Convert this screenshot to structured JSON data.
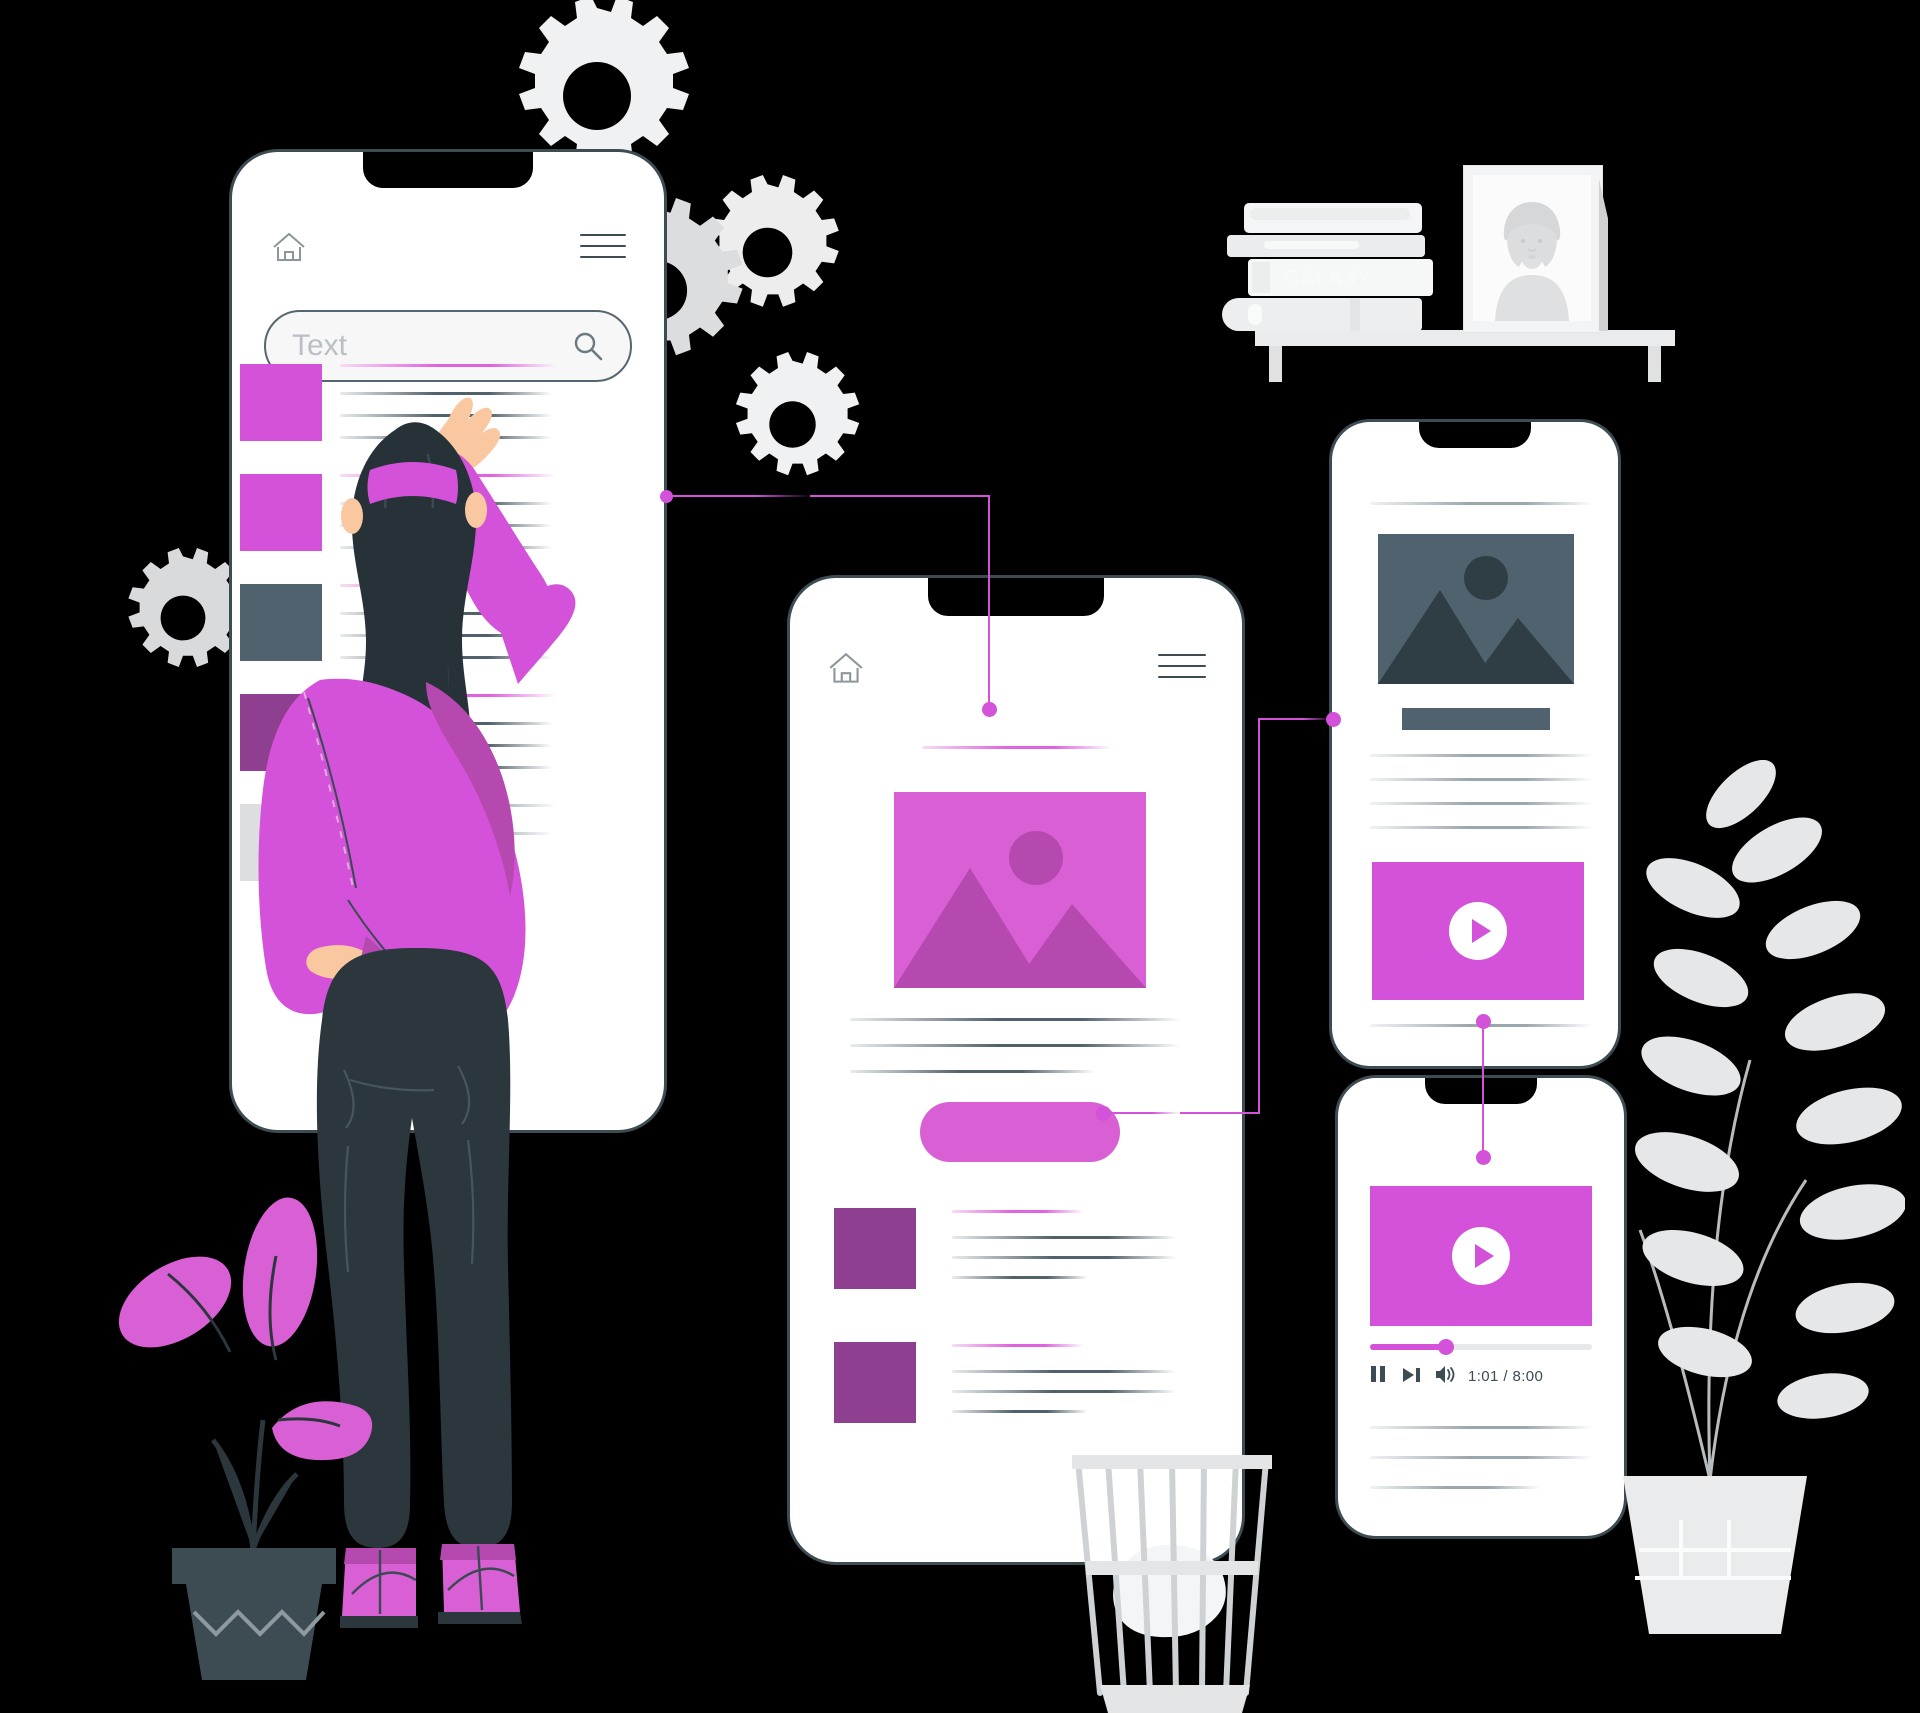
{
  "scene": {
    "title": "App design concept illustration",
    "palette": {
      "magenta": "#d352d9",
      "magenta_light": "#d95fd4",
      "magenta_deep": "#8f3f8f",
      "slate": "#3d4b53",
      "slate_mid": "#4f626d",
      "gray_light": "#e9ebec",
      "white": "#ffffff",
      "pink_leaf": "#d95fd4"
    }
  },
  "phone_left": {
    "name": "Search results phone",
    "home_icon": "home-icon",
    "menu_icon": "hamburger-menu-icon",
    "search": {
      "value": "Text",
      "placeholder": "Text",
      "icon": "search-icon"
    },
    "list_items": [
      {
        "thumb_color": "#d352d9",
        "lines": 4
      },
      {
        "thumb_color": "#d352d9",
        "lines": 4
      },
      {
        "thumb_color": "#4f626d",
        "lines": 4
      },
      {
        "thumb_color": "#dcdedf",
        "lines": 4
      }
    ]
  },
  "phone_center": {
    "name": "Article detail phone",
    "home_icon": "home-icon",
    "menu_icon": "hamburger-menu-icon",
    "hero_image": {
      "color": "#d95fd4",
      "icon": "image-placeholder-icon"
    },
    "cta_button": {
      "label": "",
      "color": "#d95fd4"
    },
    "list_items": [
      {
        "thumb_color": "#8f3f8f"
      },
      {
        "thumb_color": "#8f3f8f"
      }
    ]
  },
  "phone_top_right": {
    "name": "Media article phone",
    "hero_image": {
      "color": "#4f626d",
      "icon": "image-placeholder-icon"
    },
    "heading_bar_color": "#4f626d",
    "video_thumb": {
      "color": "#d352d9",
      "icon": "play-icon"
    }
  },
  "phone_bottom_right": {
    "name": "Video player phone",
    "video_thumb": {
      "color": "#d352d9",
      "icon": "play-icon"
    },
    "player": {
      "progress_percent": 34,
      "time_label": "1:01 / 8:00",
      "controls": [
        {
          "name": "pause-icon",
          "glyph": "pause"
        },
        {
          "name": "next-track-icon",
          "glyph": "next"
        },
        {
          "name": "volume-icon",
          "glyph": "volume"
        }
      ]
    }
  },
  "shelf": {
    "name": "wall-shelf",
    "books": [
      {
        "spine_text": ""
      },
      {
        "spine_text": ""
      },
      {
        "spine_text": "GALAXY"
      },
      {
        "spine_text": ""
      }
    ],
    "photo_frame": {
      "name": "portrait-photo-frame",
      "subject": "woman-portrait"
    }
  },
  "decor": {
    "gears": [
      {
        "name": "gear-large-top"
      },
      {
        "name": "gear-medium-right"
      },
      {
        "name": "gear-medium-left"
      },
      {
        "name": "gear-small-bottom"
      },
      {
        "name": "gear-small-far-left"
      }
    ],
    "plant_left": {
      "name": "potted-plant-pink",
      "leaf_count": 3,
      "pot_color": "#3d4b53"
    },
    "plant_right": {
      "name": "potted-plant-gray",
      "pot_color": "#e9ebec"
    },
    "waste_basket": {
      "name": "wire-waste-basket",
      "contents": "crumpled-paper"
    }
  },
  "character": {
    "name": "woman-using-app",
    "hair_color": "#263238",
    "sweater_color": "#d352d9",
    "jeans_color": "#2b363d",
    "shoes_color": "#d95fd4",
    "hair_tie_color": "#d352d9"
  }
}
